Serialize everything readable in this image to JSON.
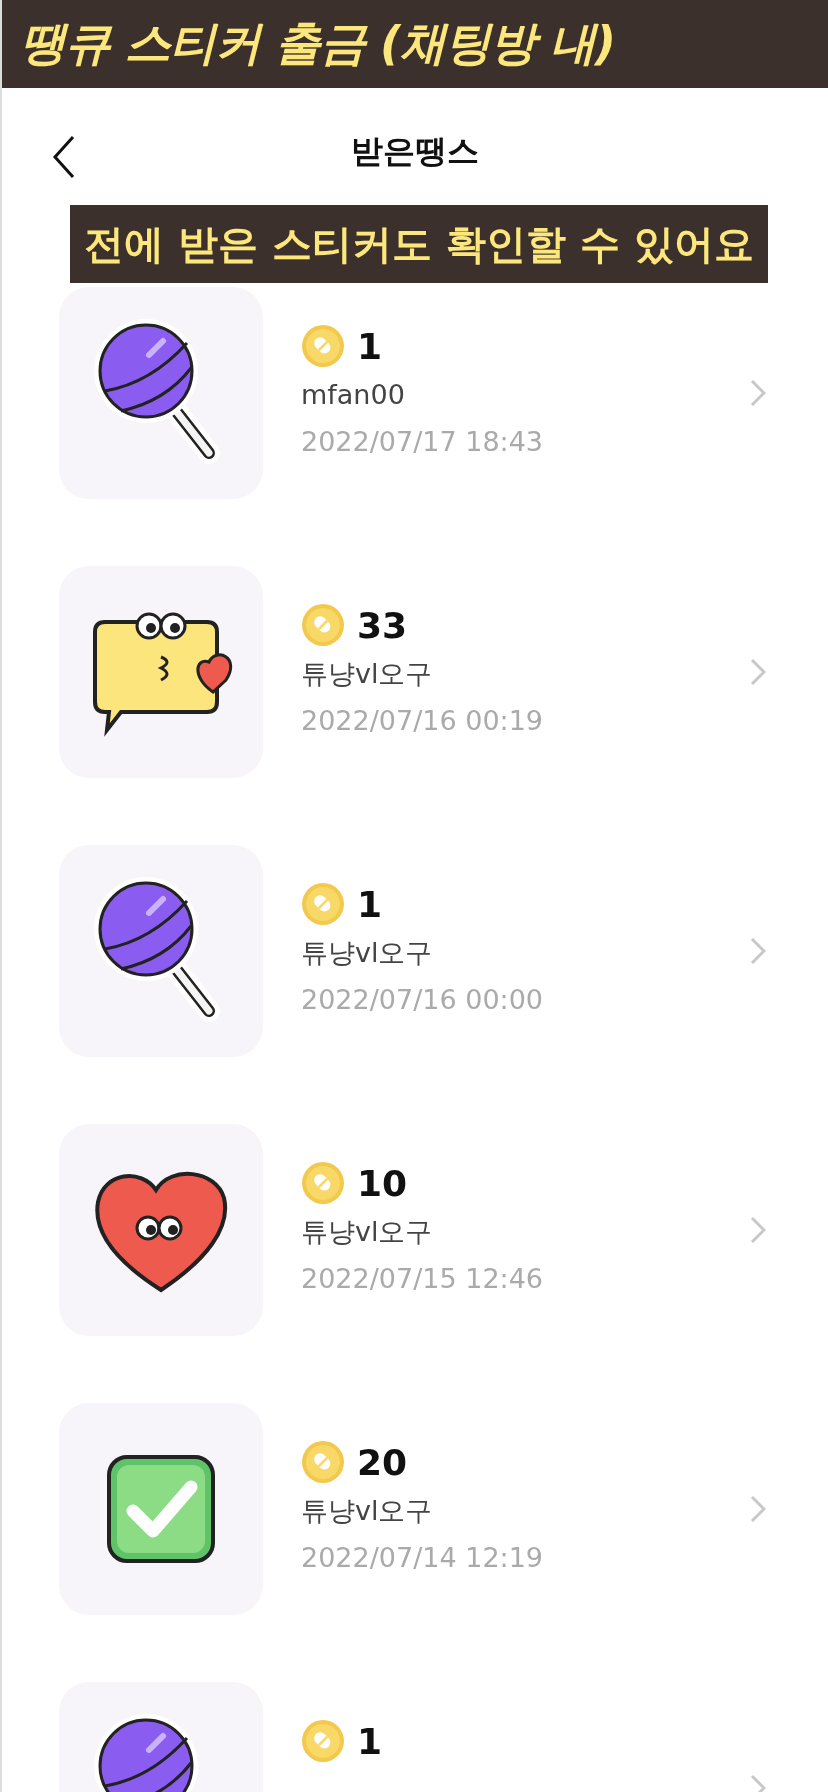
{
  "banner": {
    "title": "땡큐 스티커 출금 (채팅방 내)"
  },
  "nav": {
    "title": "받은땡스"
  },
  "caption": "전에 받은 스티커도 확인할 수 있어요",
  "items": [
    {
      "kind": "lollipop",
      "count": "1",
      "name": "mfan00",
      "date": "2022/07/17 18:43"
    },
    {
      "kind": "kiss",
      "count": "33",
      "name": "튜냥vl오구",
      "date": "2022/07/16 00:19"
    },
    {
      "kind": "lollipop",
      "count": "1",
      "name": "튜냥vl오구",
      "date": "2022/07/16 00:00"
    },
    {
      "kind": "heart",
      "count": "10",
      "name": "튜냥vl오구",
      "date": "2022/07/15 12:46"
    },
    {
      "kind": "check",
      "count": "20",
      "name": "튜냥vl오구",
      "date": "2022/07/14 12:19"
    },
    {
      "kind": "lollipop",
      "count": "1"
    }
  ]
}
